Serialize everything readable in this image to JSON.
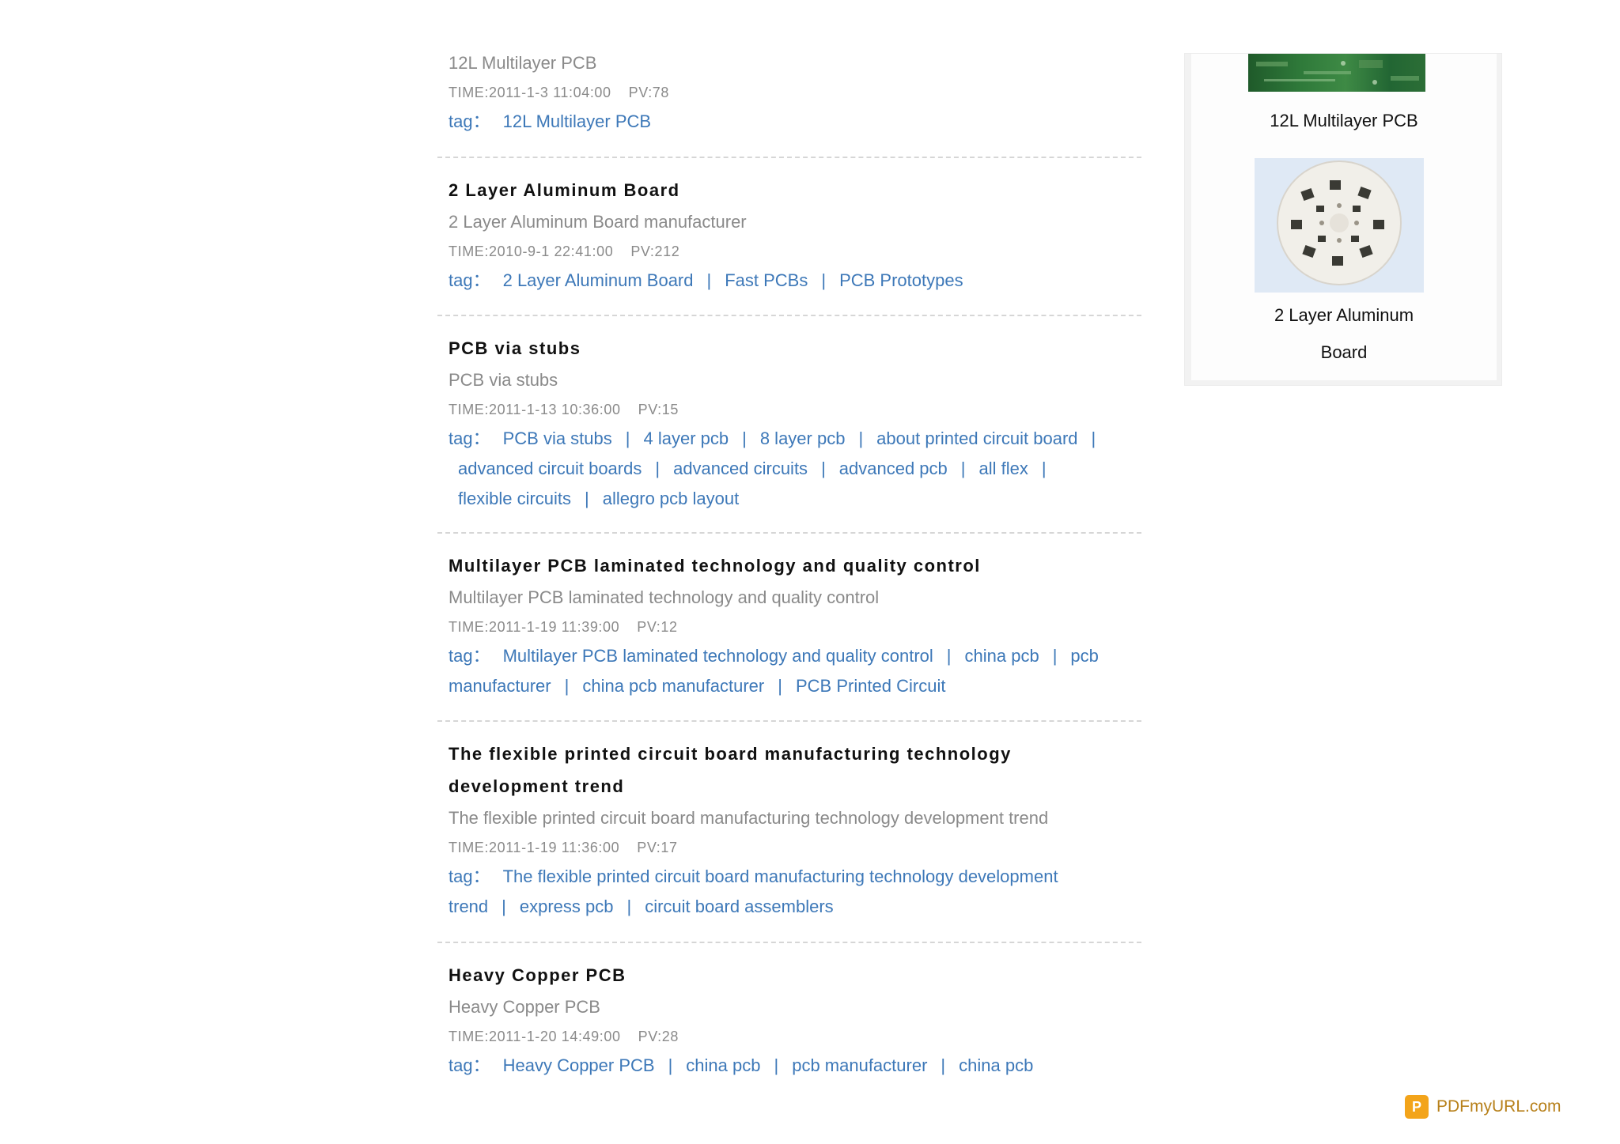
{
  "articles": [
    {
      "title": "",
      "desc": "12L Multilayer PCB",
      "time": "TIME:2011-1-3 11:04:00",
      "pv": "PV:78",
      "tag_label": "tag：",
      "tags": [
        "12L Multilayer PCB"
      ]
    },
    {
      "title": "2 Layer Aluminum Board",
      "desc": "2 Layer Aluminum Board manufacturer",
      "time": "TIME:2010-9-1 22:41:00",
      "pv": "PV:212",
      "tag_label": "tag：",
      "tags": [
        "2 Layer Aluminum Board",
        "Fast PCBs",
        "PCB Prototypes"
      ]
    },
    {
      "title": "PCB via stubs",
      "desc": "PCB via stubs",
      "time": "TIME:2011-1-13 10:36:00",
      "pv": "PV:15",
      "tag_label": "tag：",
      "tags": [
        "PCB via stubs",
        "4 layer pcb",
        "8 layer pcb",
        "about printed circuit board",
        "advanced circuit boards",
        "advanced circuits",
        "advanced pcb",
        "all flex",
        "flexible circuits",
        "allegro pcb layout"
      ]
    },
    {
      "title": "Multilayer PCB laminated technology and quality control",
      "desc": "Multilayer PCB laminated technology and quality control",
      "time": "TIME:2011-1-19 11:39:00",
      "pv": "PV:12",
      "tag_label": "tag：",
      "tags": [
        "Multilayer PCB laminated technology and quality control",
        "china pcb",
        "pcb manufacturer",
        "china pcb manufacturer",
        "PCB Printed Circuit"
      ]
    },
    {
      "title": "The flexible printed circuit board manufacturing technology development trend",
      "desc": "The flexible printed circuit board manufacturing technology development trend",
      "time": "TIME:2011-1-19 11:36:00",
      "pv": "PV:17",
      "tag_label": "tag：",
      "tags": [
        "The flexible printed circuit board manufacturing technology development trend",
        "express pcb",
        "circuit board assemblers"
      ]
    },
    {
      "title": "Heavy Copper PCB",
      "desc": "Heavy Copper PCB",
      "time": "TIME:2011-1-20 14:49:00",
      "pv": "PV:28",
      "tag_label": "tag：",
      "tags": [
        "Heavy Copper PCB",
        "china pcb",
        "pcb manufacturer",
        "china pcb"
      ]
    }
  ],
  "sidebar": {
    "items": [
      {
        "label": "12L Multilayer PCB"
      },
      {
        "label_line1": "2 Layer Aluminum",
        "label_line2": "Board"
      }
    ]
  },
  "tag_separator": "|",
  "footer": {
    "brand": "PDFmyURL.com",
    "logo_glyph": "P",
    "logo_color": "#f3a41a"
  },
  "colors": {
    "link": "#3d78b8",
    "meta": "#8a8a8a",
    "title": "#111111"
  }
}
